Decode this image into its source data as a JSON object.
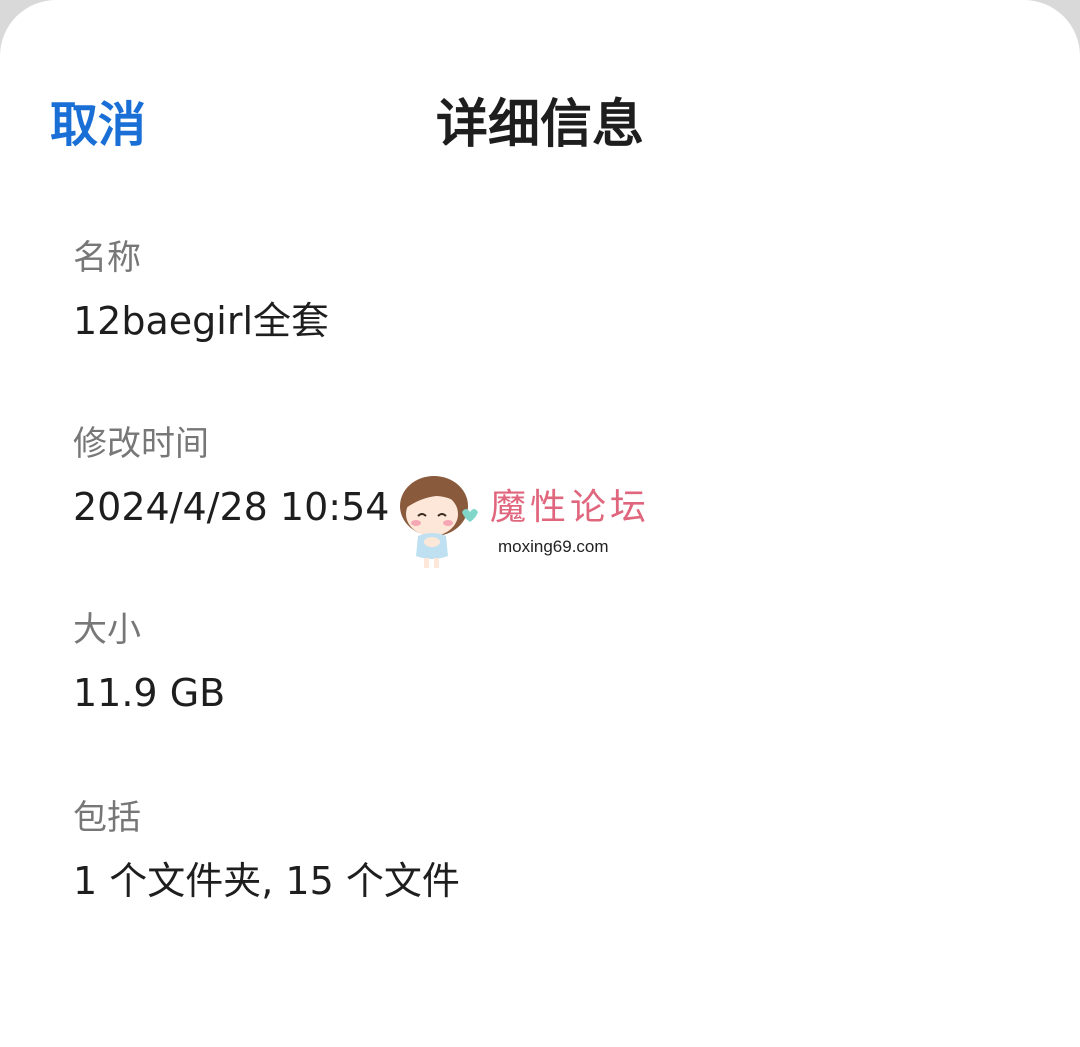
{
  "header": {
    "cancel_label": "取消",
    "title": "详细信息"
  },
  "details": {
    "name_label": "名称",
    "name_value": "12baegirl全套",
    "modified_label": "修改时间",
    "modified_value": "2024/4/28 10:54",
    "size_label": "大小",
    "size_value": "11.9 GB",
    "contains_label": "包括",
    "contains_value": "1 个文件夹, 15 个文件"
  },
  "watermark": {
    "text": "魔性论坛",
    "url": "moxing69.com"
  },
  "colors": {
    "accent": "#1a6fd6",
    "label": "#777777",
    "value": "#1e1e1e",
    "watermark": "#e0667e"
  }
}
